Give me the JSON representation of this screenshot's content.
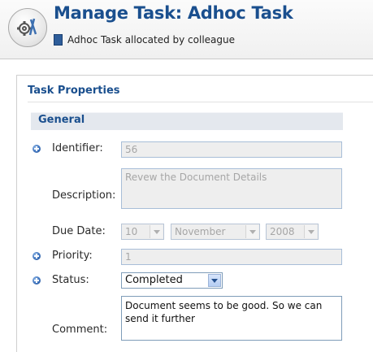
{
  "header": {
    "title": "Manage Task: Adhoc Task",
    "subtitle": "Adhoc Task allocated by colleague",
    "logo_icon": "gear-tool-icon",
    "subtitle_icon": "document-icon"
  },
  "panel": {
    "title": "Task Properties",
    "section_title": "General"
  },
  "form": {
    "identifier": {
      "label": "Identifier:",
      "value": "56",
      "required": true
    },
    "description": {
      "label": "Description:",
      "value": "Revew the Document Details",
      "required": false
    },
    "due_date": {
      "label": "Due Date:",
      "day": "10",
      "month": "November",
      "year": "2008",
      "required": false
    },
    "priority": {
      "label": "Priority:",
      "value": "1",
      "required": true
    },
    "status": {
      "label": "Status:",
      "value": "Completed",
      "required": true
    },
    "comment": {
      "label": "Comment:",
      "value": "Document seems to be good. So we can send it further",
      "required": false
    }
  },
  "colors": {
    "accent": "#1a4f8e",
    "section_bar": "#e4e8ee",
    "disabled_field": "#eeeeee",
    "field_border": "#a8bed8"
  }
}
